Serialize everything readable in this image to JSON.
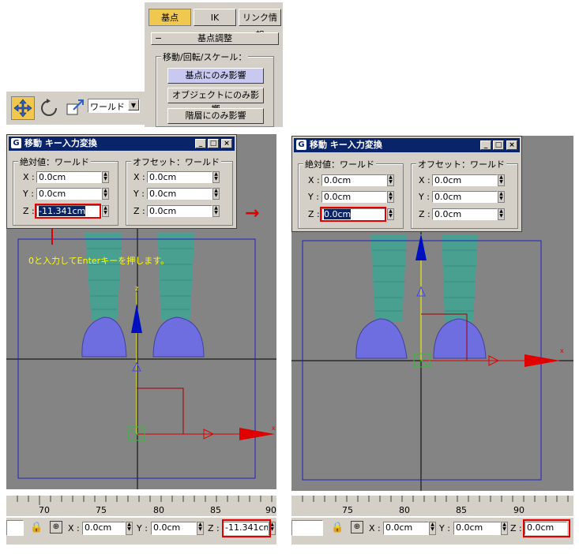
{
  "top_panel": {
    "tabs": [
      "基点",
      "IK",
      "リンク情報"
    ],
    "rollout_title": "基点調整",
    "rollout_collapse": "−",
    "group_label": "移動/回転/スケール：",
    "buttons": [
      "基点にのみ影響",
      "オブジェクトにのみ影響",
      "階層にのみ影響"
    ]
  },
  "toolbar": {
    "coord_system": "ワールド",
    "dropdown_arrow": "▼"
  },
  "dialog_left": {
    "title": "移動 キー入力変換",
    "absolute_label": "絶対値：ワールド",
    "offset_label": "オフセット：ワールド",
    "abs_fields": [
      {
        "label": "X :",
        "value": "0.0cm"
      },
      {
        "label": "Y :",
        "value": "0.0cm"
      },
      {
        "label": "Z :",
        "value": "-11.341cm"
      }
    ],
    "off_fields": [
      {
        "label": "X :",
        "value": "0.0cm"
      },
      {
        "label": "Y :",
        "value": "0.0cm"
      },
      {
        "label": "Z :",
        "value": "0.0cm"
      }
    ]
  },
  "dialog_right": {
    "title": "移動 キー入力変換",
    "absolute_label": "絶対値：ワールド",
    "offset_label": "オフセット：ワールド",
    "abs_fields": [
      {
        "label": "X :",
        "value": "0.0cm"
      },
      {
        "label": "Y :",
        "value": "0.0cm"
      },
      {
        "label": "Z :",
        "value": "0.0cm"
      }
    ],
    "off_fields": [
      {
        "label": "X :",
        "value": "0.0cm"
      },
      {
        "label": "Y :",
        "value": "0.0cm"
      },
      {
        "label": "Z :",
        "value": "0.0cm"
      }
    ]
  },
  "annotation": "0と入力してEnterキーを押します。",
  "arrow_glyph": "→",
  "viewport_axes": {
    "z": "z",
    "x": "x"
  },
  "ruler_left": [
    "70",
    "75",
    "80",
    "85",
    "90"
  ],
  "ruler_right": [
    "75",
    "80",
    "85",
    "90"
  ],
  "status_left": {
    "x_label": "X :",
    "x": "0.0cm",
    "y_label": "Y :",
    "y": "0.0cm",
    "z_label": "Z :",
    "z": "-11.341cm"
  },
  "status_right": {
    "x_label": "X :",
    "x": "0.0cm",
    "y_label": "Y :",
    "y": "0.0cm",
    "z_label": "Z :",
    "z": "0.0cm"
  },
  "colors": {
    "title_bar": "#0a246a",
    "highlight": "#e00000",
    "viewport": "#848484",
    "mesh": "#3aa89a",
    "shoe": "#6e6ee0",
    "annotation": "#ffff00"
  }
}
